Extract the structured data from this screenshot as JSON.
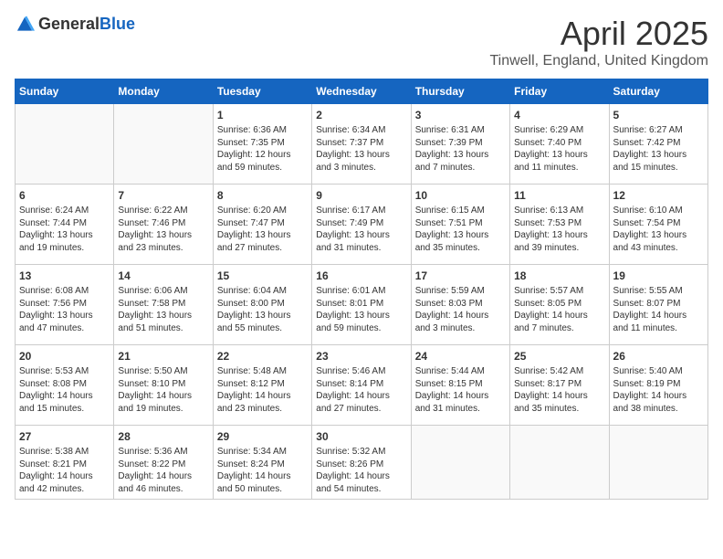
{
  "header": {
    "logo_general": "General",
    "logo_blue": "Blue",
    "month_year": "April 2025",
    "location": "Tinwell, England, United Kingdom"
  },
  "weekdays": [
    "Sunday",
    "Monday",
    "Tuesday",
    "Wednesday",
    "Thursday",
    "Friday",
    "Saturday"
  ],
  "weeks": [
    [
      {
        "day": null
      },
      {
        "day": null
      },
      {
        "day": 1,
        "sunrise": "6:36 AM",
        "sunset": "7:35 PM",
        "daylight": "12 hours and 59 minutes."
      },
      {
        "day": 2,
        "sunrise": "6:34 AM",
        "sunset": "7:37 PM",
        "daylight": "13 hours and 3 minutes."
      },
      {
        "day": 3,
        "sunrise": "6:31 AM",
        "sunset": "7:39 PM",
        "daylight": "13 hours and 7 minutes."
      },
      {
        "day": 4,
        "sunrise": "6:29 AM",
        "sunset": "7:40 PM",
        "daylight": "13 hours and 11 minutes."
      },
      {
        "day": 5,
        "sunrise": "6:27 AM",
        "sunset": "7:42 PM",
        "daylight": "13 hours and 15 minutes."
      }
    ],
    [
      {
        "day": 6,
        "sunrise": "6:24 AM",
        "sunset": "7:44 PM",
        "daylight": "13 hours and 19 minutes."
      },
      {
        "day": 7,
        "sunrise": "6:22 AM",
        "sunset": "7:46 PM",
        "daylight": "13 hours and 23 minutes."
      },
      {
        "day": 8,
        "sunrise": "6:20 AM",
        "sunset": "7:47 PM",
        "daylight": "13 hours and 27 minutes."
      },
      {
        "day": 9,
        "sunrise": "6:17 AM",
        "sunset": "7:49 PM",
        "daylight": "13 hours and 31 minutes."
      },
      {
        "day": 10,
        "sunrise": "6:15 AM",
        "sunset": "7:51 PM",
        "daylight": "13 hours and 35 minutes."
      },
      {
        "day": 11,
        "sunrise": "6:13 AM",
        "sunset": "7:53 PM",
        "daylight": "13 hours and 39 minutes."
      },
      {
        "day": 12,
        "sunrise": "6:10 AM",
        "sunset": "7:54 PM",
        "daylight": "13 hours and 43 minutes."
      }
    ],
    [
      {
        "day": 13,
        "sunrise": "6:08 AM",
        "sunset": "7:56 PM",
        "daylight": "13 hours and 47 minutes."
      },
      {
        "day": 14,
        "sunrise": "6:06 AM",
        "sunset": "7:58 PM",
        "daylight": "13 hours and 51 minutes."
      },
      {
        "day": 15,
        "sunrise": "6:04 AM",
        "sunset": "8:00 PM",
        "daylight": "13 hours and 55 minutes."
      },
      {
        "day": 16,
        "sunrise": "6:01 AM",
        "sunset": "8:01 PM",
        "daylight": "13 hours and 59 minutes."
      },
      {
        "day": 17,
        "sunrise": "5:59 AM",
        "sunset": "8:03 PM",
        "daylight": "14 hours and 3 minutes."
      },
      {
        "day": 18,
        "sunrise": "5:57 AM",
        "sunset": "8:05 PM",
        "daylight": "14 hours and 7 minutes."
      },
      {
        "day": 19,
        "sunrise": "5:55 AM",
        "sunset": "8:07 PM",
        "daylight": "14 hours and 11 minutes."
      }
    ],
    [
      {
        "day": 20,
        "sunrise": "5:53 AM",
        "sunset": "8:08 PM",
        "daylight": "14 hours and 15 minutes."
      },
      {
        "day": 21,
        "sunrise": "5:50 AM",
        "sunset": "8:10 PM",
        "daylight": "14 hours and 19 minutes."
      },
      {
        "day": 22,
        "sunrise": "5:48 AM",
        "sunset": "8:12 PM",
        "daylight": "14 hours and 23 minutes."
      },
      {
        "day": 23,
        "sunrise": "5:46 AM",
        "sunset": "8:14 PM",
        "daylight": "14 hours and 27 minutes."
      },
      {
        "day": 24,
        "sunrise": "5:44 AM",
        "sunset": "8:15 PM",
        "daylight": "14 hours and 31 minutes."
      },
      {
        "day": 25,
        "sunrise": "5:42 AM",
        "sunset": "8:17 PM",
        "daylight": "14 hours and 35 minutes."
      },
      {
        "day": 26,
        "sunrise": "5:40 AM",
        "sunset": "8:19 PM",
        "daylight": "14 hours and 38 minutes."
      }
    ],
    [
      {
        "day": 27,
        "sunrise": "5:38 AM",
        "sunset": "8:21 PM",
        "daylight": "14 hours and 42 minutes."
      },
      {
        "day": 28,
        "sunrise": "5:36 AM",
        "sunset": "8:22 PM",
        "daylight": "14 hours and 46 minutes."
      },
      {
        "day": 29,
        "sunrise": "5:34 AM",
        "sunset": "8:24 PM",
        "daylight": "14 hours and 50 minutes."
      },
      {
        "day": 30,
        "sunrise": "5:32 AM",
        "sunset": "8:26 PM",
        "daylight": "14 hours and 54 minutes."
      },
      {
        "day": null
      },
      {
        "day": null
      },
      {
        "day": null
      }
    ]
  ]
}
